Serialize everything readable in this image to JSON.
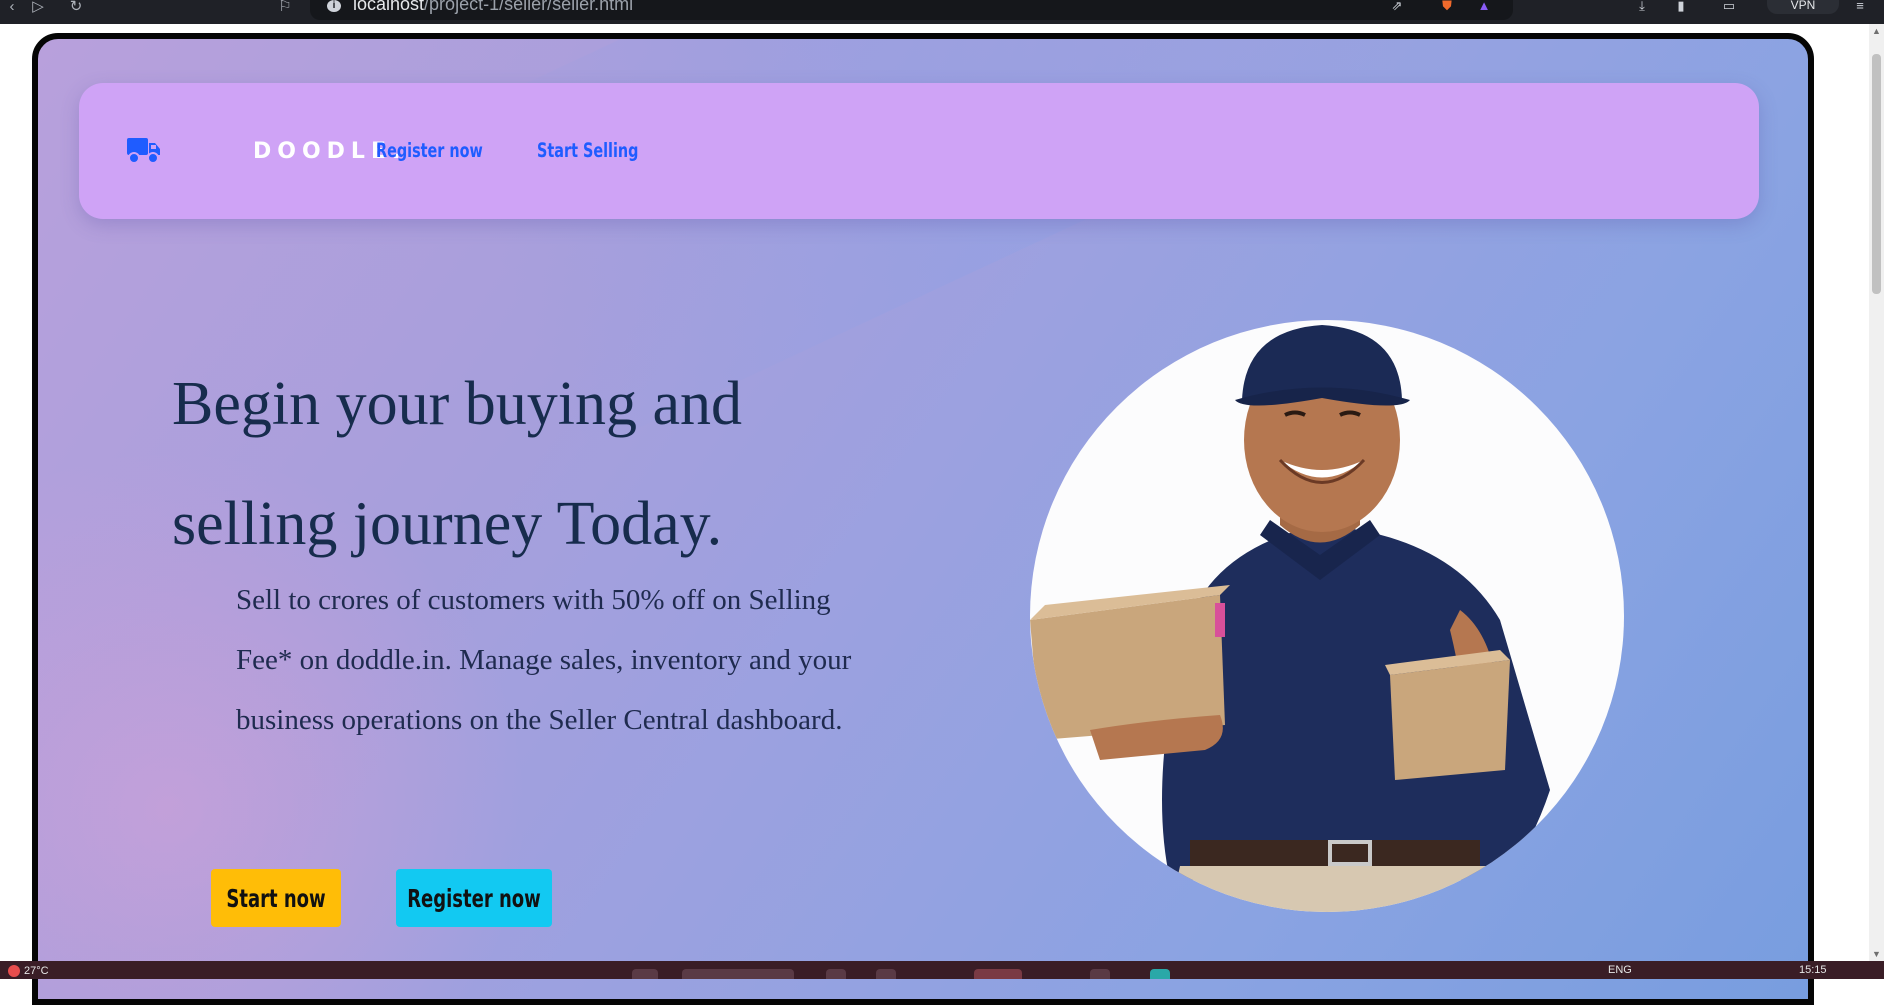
{
  "browser": {
    "url_host": "localhost",
    "url_path": "/project-1/seller/seller.html",
    "vpn_label": "VPN"
  },
  "navbar": {
    "brand": "DOODLE.",
    "links": [
      "Register now",
      "Start Selling"
    ]
  },
  "hero": {
    "title": "Begin your buying and selling journey Today.",
    "description": "Sell to crores of customers with 50% off on Selling Fee* on doddle.in. Manage sales, inventory and your business operations on the Seller Central dashboard.",
    "buttons": {
      "start": "Start now",
      "register": "Register now"
    },
    "image_icon": "delivery-man-photo"
  },
  "colors": {
    "navbar_bg": "#cfa3f6",
    "link_blue": "#1f5cff",
    "start_button": "#ffbd07",
    "register_button": "#12c9f2",
    "title_text": "#172c4d"
  },
  "taskbar": {
    "weather": "27°C",
    "language": "ENG",
    "time": "15:15"
  }
}
